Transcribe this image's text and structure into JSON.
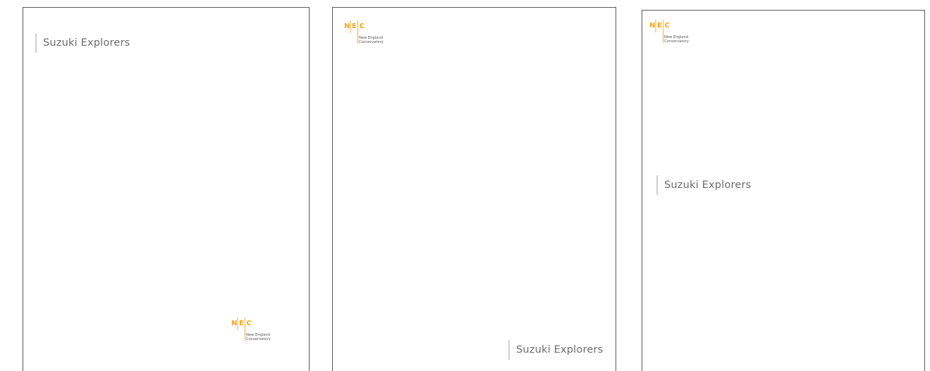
{
  "brand": {
    "mark_letters": [
      "N",
      "E",
      "C"
    ],
    "name_line_1": "New England",
    "name_line_2": "Conservatory",
    "accent_color": "#F4A61C",
    "text_color": "#555555"
  },
  "program": {
    "name": "Suzuki Explorers",
    "color": "#6b6b6b",
    "divider_color": "#cfcfcf"
  },
  "pages": [
    {
      "layout": "title-top-left, logo-bottom-right"
    },
    {
      "layout": "logo-top-left, title-bottom-right"
    },
    {
      "layout": "logo-top-left, title-middle-left"
    }
  ]
}
